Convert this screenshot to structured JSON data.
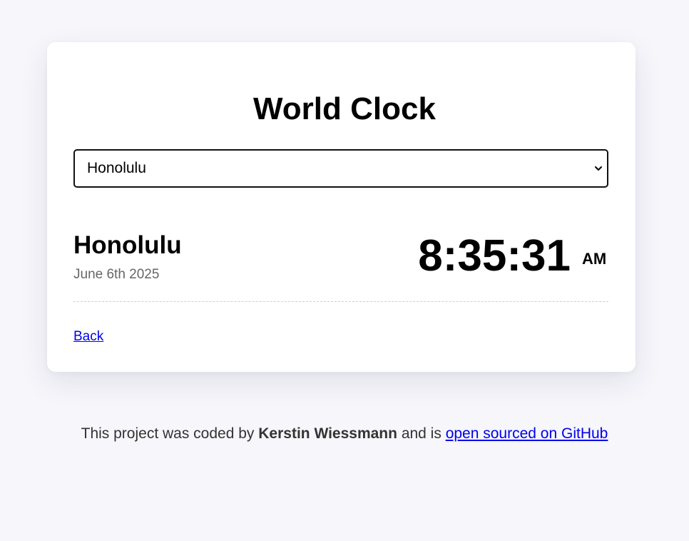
{
  "header": {
    "title": "World Clock"
  },
  "city_select": {
    "selected": "Honolulu"
  },
  "clock": {
    "city": "Honolulu",
    "date": "June 6th 2025",
    "time": "8:35:31",
    "period": "AM"
  },
  "nav": {
    "back_label": "Back"
  },
  "footer": {
    "prefix": "This project was coded by",
    "author": "Kerstin Wiessmann",
    "middle": "and is",
    "link_label": "open sourced on GitHub"
  },
  "colors": {
    "background": "#f6f6fb",
    "card": "#ffffff",
    "link": "#0000ee",
    "muted_text": "#666666"
  },
  "icons": {
    "select_arrow": "chevron-down-icon"
  }
}
